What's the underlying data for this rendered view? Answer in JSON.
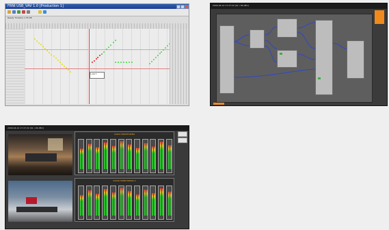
{
  "panel1": {
    "title": "FRNI USB_VAV 1.0 [Production 1]",
    "status": "Ready  Timeline  1:35:08",
    "label": "1.00 T"
  },
  "panel2": {
    "header": "2009-04-14 17:27:22 (91 / 96 dBU)"
  },
  "panel3": {
    "header": "2009-04-14 17:27:22 (91 / 96 dBU)",
    "strip_top": "AUDIO MONITORING",
    "strip_bottom": "AUDIO MONITORING 2"
  }
}
